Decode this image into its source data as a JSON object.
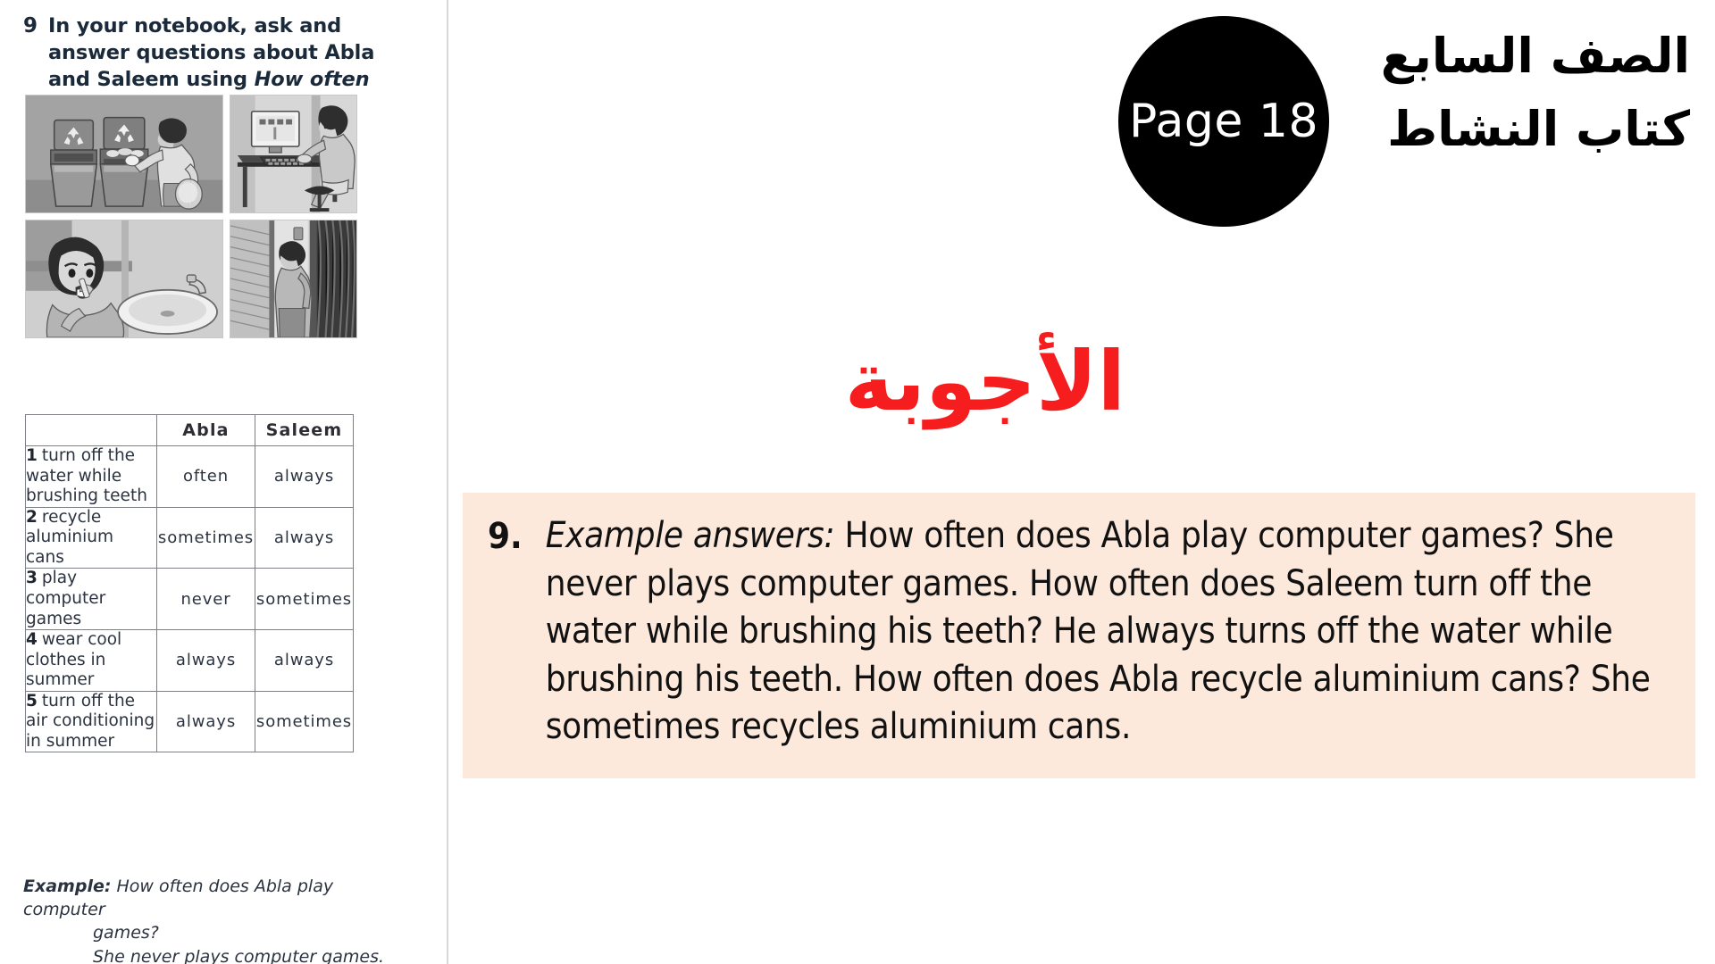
{
  "exercise": {
    "number": "9",
    "instruction_part1": "In your notebook, ask and answer questions about Abla and Saleem using ",
    "instruction_italic": "How often ...?"
  },
  "illustrations": [
    {
      "name": "recycling-bins-illustration",
      "caption": "Boy putting can into recycling bin"
    },
    {
      "name": "computer-desk-illustration",
      "caption": "Boy using a computer at a desk"
    },
    {
      "name": "brushing-teeth-illustration",
      "caption": "Girl brushing her teeth at a sink"
    },
    {
      "name": "window-air-conditioning-illustration",
      "caption": "Person standing by a window with curtains"
    }
  ],
  "table": {
    "headers": [
      "",
      "Abla",
      "Saleem"
    ],
    "rows": [
      {
        "num": "1",
        "activity": "turn off the water while brushing teeth",
        "abla": "often",
        "saleem": "always"
      },
      {
        "num": "2",
        "activity": "recycle aluminium cans",
        "abla": "sometimes",
        "saleem": "always"
      },
      {
        "num": "3",
        "activity": "play computer games",
        "abla": "never",
        "saleem": "sometimes"
      },
      {
        "num": "4",
        "activity": "wear cool clothes in summer",
        "abla": "always",
        "saleem": "always"
      },
      {
        "num": "5",
        "activity": "turn off the air conditioning in summer",
        "abla": "always",
        "saleem": "sometimes"
      }
    ]
  },
  "example_note": {
    "label": "Example:",
    "line1": "How often does Abla play computer",
    "line2": "games?",
    "line3": "She never plays computer games."
  },
  "badge": {
    "text": "Page 18"
  },
  "arabic_header": {
    "line1": "الصف السابع",
    "line2": "كتاب النشاط"
  },
  "answers_title": "الأجوبة",
  "answer": {
    "number": "9.",
    "lead": "Example answers:",
    "text": " How often does Abla play computer games? She never plays computer games. How often does Saleem turn off the water while brushing his teeth? He always turns off the water while brushing his teeth. How often does Abla recycle aluminium cans? She sometimes recycles aluminium cans."
  },
  "colors": {
    "answer_box_background": "#fce9dc",
    "answers_title_red": "#f51d1d",
    "badge_background": "#000000",
    "text_dark": "#1b2a3a"
  }
}
